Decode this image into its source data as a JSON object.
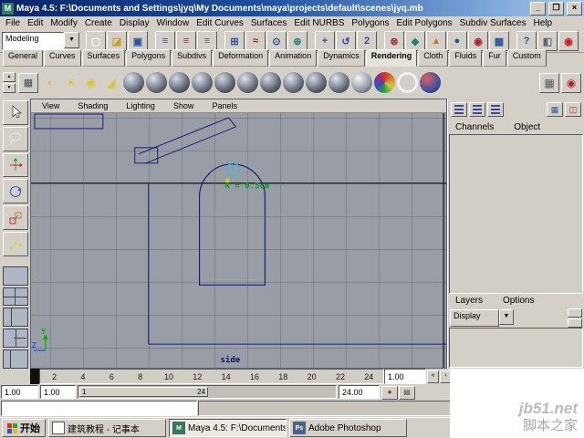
{
  "window": {
    "icon_letter": "M",
    "title": "Maya 4.5: F:\\Documents and Settings\\jyq\\My Documents\\maya\\projects\\default\\scenes\\jyq.mb",
    "minimize": "_",
    "maximize": "❐",
    "close": "×"
  },
  "menubar": {
    "items": [
      "File",
      "Edit",
      "Modify",
      "Create",
      "Display",
      "Window",
      "Edit Curves",
      "Surfaces",
      "Edit NURBS",
      "Polygons",
      "Edit Polygons",
      "Subdiv Surfaces",
      "Help"
    ]
  },
  "toolbar": {
    "mode": "Modeling",
    "dropdown_arrow": "▼",
    "icons": [
      {
        "name": "new-scene-icon",
        "glyph": "▢",
        "color": "#f8f8f8"
      },
      {
        "name": "open-scene-icon",
        "glyph": "◪",
        "color": "#c8a028"
      },
      {
        "name": "save-scene-icon",
        "glyph": "▣",
        "color": "#2850a0"
      },
      {
        "name": "select-hierarchy-icon",
        "glyph": "≡",
        "color": "#2850a0"
      },
      {
        "name": "select-object-icon",
        "glyph": "≡",
        "color": "#a02828"
      },
      {
        "name": "select-component-icon",
        "glyph": "≡",
        "color": "#208040"
      },
      {
        "name": "snap-grid-icon",
        "glyph": "⊞",
        "color": "#2850a0"
      },
      {
        "name": "snap-curve-icon",
        "glyph": "≈",
        "color": "#a02828"
      },
      {
        "name": "snap-point-icon",
        "glyph": "⊙",
        "color": "#2850a0"
      },
      {
        "name": "snap-view-plane-icon",
        "glyph": "⊕",
        "color": "#188080"
      },
      {
        "name": "make-live-icon",
        "glyph": "+",
        "color": "#2850a0"
      },
      {
        "name": "construction-history-icon",
        "glyph": "↺",
        "color": "#2850a0"
      },
      {
        "name": "input-connections-icon",
        "glyph": "2",
        "color": "#2850a0"
      },
      {
        "name": "output-connections-icon",
        "glyph": "⊗",
        "color": "#a02828"
      },
      {
        "name": "highlight-selection-icon",
        "glyph": "◆",
        "color": "#188080"
      },
      {
        "name": "list-input-icon",
        "glyph": "▲",
        "color": "#c87820"
      },
      {
        "name": "quick-select-icon",
        "glyph": "●",
        "color": "#2850a0"
      },
      {
        "name": "render-globe-icon",
        "glyph": "◉",
        "color": "#a02828"
      },
      {
        "name": "grid-display-icon",
        "glyph": "▦",
        "color": "#2850a0"
      },
      {
        "name": "help-icon",
        "glyph": "?",
        "color": "#2850a0"
      },
      {
        "name": "render-view-icon",
        "glyph": "◧",
        "color": "#606870"
      },
      {
        "name": "ipr-render-icon",
        "glyph": "◉",
        "color": "#c82020"
      }
    ]
  },
  "shelf": {
    "tabs": [
      "General",
      "Curves",
      "Surfaces",
      "Polygons",
      "Subdivs",
      "Deformation",
      "Animation",
      "Dynamics",
      "Rendering",
      "Cloth",
      "Fluids",
      "Fur",
      "Custom"
    ],
    "active_tab": "Rendering",
    "arrow_up": "▲",
    "arrow_down": "▼",
    "menu_glyph": "▦",
    "lights": [
      {
        "name": "ambient-light-icon",
        "glyph": "◐",
        "color": "#d8c840"
      },
      {
        "name": "directional-light-icon",
        "glyph": "☀",
        "color": "#d8c840"
      },
      {
        "name": "point-light-icon",
        "glyph": "◉",
        "color": "#d8c840"
      },
      {
        "name": "spot-light-icon",
        "glyph": "◢",
        "color": "#d8c840"
      }
    ],
    "materials": [
      {
        "name": "anisotropic-sphere-icon",
        "bg": "radial-gradient(circle at 35% 30%, #dfe4ec, #707684 55%, #262a33)"
      },
      {
        "name": "blinn-sphere-icon",
        "bg": "radial-gradient(circle at 35% 30%, #dfe4ec, #707684 55%, #262a33)"
      },
      {
        "name": "lambert-sphere-icon",
        "bg": "radial-gradient(circle at 35% 30%, #d4dae4, #666c7a 55%, #22262e)"
      },
      {
        "name": "phong-sphere-icon",
        "bg": "radial-gradient(circle at 35% 30%, #dfe4ec, #707684 55%, #262a33)"
      },
      {
        "name": "phonge-sphere-icon",
        "bg": "radial-gradient(circle at 35% 30%, #d4dae4, #666c7a 55%, #22262e)"
      },
      {
        "name": "layered-shader-sphere-icon",
        "bg": "radial-gradient(circle at 35% 30%, #dfe4ec, #707684 55%, #262a33)"
      },
      {
        "name": "shading-map-sphere-icon",
        "bg": "radial-gradient(circle at 35% 30%, #d4dae4, #666c7a 55%, #22262e)"
      },
      {
        "name": "surface-shader-sphere-icon",
        "bg": "radial-gradient(circle at 35% 30%, #dfe4ec, #707684 55%, #262a33)"
      },
      {
        "name": "use-background-sphere-icon",
        "bg": "radial-gradient(circle at 35% 30%, #d4dae4, #666c7a 55%, #22262e)"
      },
      {
        "name": "ocean-shader-sphere-icon",
        "bg": "radial-gradient(circle at 35% 30%, #dfe4ec, #707684 55%, #262a33)"
      },
      {
        "name": "ramp-shader-sphere-icon",
        "bg": "radial-gradient(circle at 35% 30%, #f2f4f8, #9aa0ac 55%, #3a3e48)"
      },
      {
        "name": "marble-texture-sphere-icon",
        "bg": "conic-gradient(#d03030,#d08030,#d0d030,#30a040,#3050c0,#8030a0,#d03030)"
      },
      {
        "name": "ring-texture-icon",
        "bg": "radial-gradient(circle, rgba(0,0,0,0) 52%, #eef1f6 53% 72%, rgba(0,0,0,0) 73%)"
      },
      {
        "name": "blend-colors-sphere-icon",
        "bg": "radial-gradient(circle at 35% 30%, #e06060, #4050a0 60%, #202848)"
      }
    ],
    "right_buttons": [
      {
        "name": "render-current-frame-icon",
        "glyph": "▦",
        "color": "#505868"
      },
      {
        "name": "ipr-render-shelf-icon",
        "glyph": "◉",
        "color": "#b02020"
      }
    ]
  },
  "toolbox": {
    "tools": [
      "select-tool",
      "lasso-tool",
      "move-tool",
      "rotate-tool",
      "scale-tool",
      "show-manipulator-tool"
    ],
    "layouts": [
      "single-pane",
      "four-pane",
      "two-pane",
      "three-pane",
      "outliner-persp"
    ]
  },
  "viewport": {
    "menu": [
      "View",
      "Shading",
      "Lighting",
      "Show",
      "Panels"
    ],
    "annotation": "R = 0.5cm",
    "view_label": "side",
    "axis_y": "Y",
    "axis_z": "Z"
  },
  "channel_box": {
    "menu": [
      "Channels",
      "Object"
    ],
    "panel_icons": [
      {
        "name": "show-channel-box-icon"
      },
      {
        "name": "show-layer-editor-icon"
      },
      {
        "name": "show-channel-layer-icon"
      }
    ],
    "right_icons": [
      {
        "name": "persp-layout-icon",
        "glyph": "▦",
        "color": "#3050a0"
      },
      {
        "name": "hypergraph-icon",
        "glyph": "◫",
        "color": "#a03030"
      }
    ]
  },
  "layer_editor": {
    "menu": [
      "Layers",
      "Options"
    ],
    "display": "Display",
    "arrow": "▼"
  },
  "time_slider": {
    "ticks": [
      "2",
      "4",
      "6",
      "8",
      "10",
      "12",
      "14",
      "16",
      "18",
      "20",
      "22",
      "24"
    ],
    "current_time": "1.00",
    "playback": [
      {
        "name": "go-to-start-button",
        "glyph": "«"
      },
      {
        "name": "step-back-button",
        "glyph": "‹"
      },
      {
        "name": "step-forward-button",
        "glyph": "›"
      },
      {
        "name": "play-forward-button",
        "glyph": "»"
      }
    ]
  },
  "range_slider": {
    "anim_start": "1.00",
    "playback_start": "1.00",
    "handle_start": "1",
    "handle_end": "24",
    "playback_end": "24.00",
    "buttons": [
      {
        "name": "auto-key-button",
        "glyph": "●",
        "color": "#a02020"
      },
      {
        "name": "anim-preferences-button",
        "glyph": "▤",
        "color": "#404040"
      }
    ]
  },
  "taskbar": {
    "start": "开始",
    "flag_colors": [
      "#e03020",
      "#30a030",
      "#2858c8",
      "#e8b820"
    ],
    "tasks": [
      {
        "label": "建筑教程 - 记事本",
        "icon_letter": "",
        "icon_bg": "#ffffff"
      },
      {
        "label": "Maya 4.5: F:\\Documents...",
        "icon_letter": "M",
        "icon_bg": "#2f7d5c"
      },
      {
        "label": "Adobe Photoshop",
        "icon_letter": "Ps",
        "icon_bg": "#46628e"
      }
    ]
  },
  "watermark": {
    "line1": "jb51.net",
    "line2": "脚本之家"
  }
}
